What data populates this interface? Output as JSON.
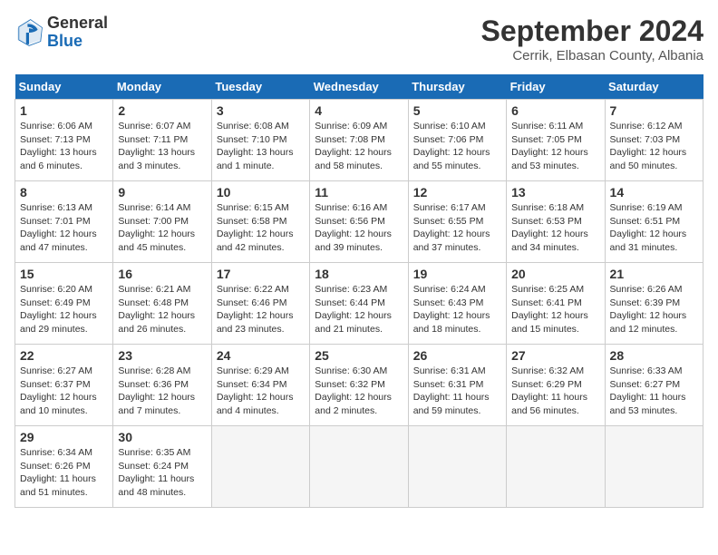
{
  "header": {
    "logo_general": "General",
    "logo_blue": "Blue",
    "month_title": "September 2024",
    "location": "Cerrik, Elbasan County, Albania"
  },
  "columns": [
    "Sunday",
    "Monday",
    "Tuesday",
    "Wednesday",
    "Thursday",
    "Friday",
    "Saturday"
  ],
  "weeks": [
    [
      {
        "day": "1",
        "info": "Sunrise: 6:06 AM\nSunset: 7:13 PM\nDaylight: 13 hours\nand 6 minutes."
      },
      {
        "day": "2",
        "info": "Sunrise: 6:07 AM\nSunset: 7:11 PM\nDaylight: 13 hours\nand 3 minutes."
      },
      {
        "day": "3",
        "info": "Sunrise: 6:08 AM\nSunset: 7:10 PM\nDaylight: 13 hours\nand 1 minute."
      },
      {
        "day": "4",
        "info": "Sunrise: 6:09 AM\nSunset: 7:08 PM\nDaylight: 12 hours\nand 58 minutes."
      },
      {
        "day": "5",
        "info": "Sunrise: 6:10 AM\nSunset: 7:06 PM\nDaylight: 12 hours\nand 55 minutes."
      },
      {
        "day": "6",
        "info": "Sunrise: 6:11 AM\nSunset: 7:05 PM\nDaylight: 12 hours\nand 53 minutes."
      },
      {
        "day": "7",
        "info": "Sunrise: 6:12 AM\nSunset: 7:03 PM\nDaylight: 12 hours\nand 50 minutes."
      }
    ],
    [
      {
        "day": "8",
        "info": "Sunrise: 6:13 AM\nSunset: 7:01 PM\nDaylight: 12 hours\nand 47 minutes."
      },
      {
        "day": "9",
        "info": "Sunrise: 6:14 AM\nSunset: 7:00 PM\nDaylight: 12 hours\nand 45 minutes."
      },
      {
        "day": "10",
        "info": "Sunrise: 6:15 AM\nSunset: 6:58 PM\nDaylight: 12 hours\nand 42 minutes."
      },
      {
        "day": "11",
        "info": "Sunrise: 6:16 AM\nSunset: 6:56 PM\nDaylight: 12 hours\nand 39 minutes."
      },
      {
        "day": "12",
        "info": "Sunrise: 6:17 AM\nSunset: 6:55 PM\nDaylight: 12 hours\nand 37 minutes."
      },
      {
        "day": "13",
        "info": "Sunrise: 6:18 AM\nSunset: 6:53 PM\nDaylight: 12 hours\nand 34 minutes."
      },
      {
        "day": "14",
        "info": "Sunrise: 6:19 AM\nSunset: 6:51 PM\nDaylight: 12 hours\nand 31 minutes."
      }
    ],
    [
      {
        "day": "15",
        "info": "Sunrise: 6:20 AM\nSunset: 6:49 PM\nDaylight: 12 hours\nand 29 minutes."
      },
      {
        "day": "16",
        "info": "Sunrise: 6:21 AM\nSunset: 6:48 PM\nDaylight: 12 hours\nand 26 minutes."
      },
      {
        "day": "17",
        "info": "Sunrise: 6:22 AM\nSunset: 6:46 PM\nDaylight: 12 hours\nand 23 minutes."
      },
      {
        "day": "18",
        "info": "Sunrise: 6:23 AM\nSunset: 6:44 PM\nDaylight: 12 hours\nand 21 minutes."
      },
      {
        "day": "19",
        "info": "Sunrise: 6:24 AM\nSunset: 6:43 PM\nDaylight: 12 hours\nand 18 minutes."
      },
      {
        "day": "20",
        "info": "Sunrise: 6:25 AM\nSunset: 6:41 PM\nDaylight: 12 hours\nand 15 minutes."
      },
      {
        "day": "21",
        "info": "Sunrise: 6:26 AM\nSunset: 6:39 PM\nDaylight: 12 hours\nand 12 minutes."
      }
    ],
    [
      {
        "day": "22",
        "info": "Sunrise: 6:27 AM\nSunset: 6:37 PM\nDaylight: 12 hours\nand 10 minutes."
      },
      {
        "day": "23",
        "info": "Sunrise: 6:28 AM\nSunset: 6:36 PM\nDaylight: 12 hours\nand 7 minutes."
      },
      {
        "day": "24",
        "info": "Sunrise: 6:29 AM\nSunset: 6:34 PM\nDaylight: 12 hours\nand 4 minutes."
      },
      {
        "day": "25",
        "info": "Sunrise: 6:30 AM\nSunset: 6:32 PM\nDaylight: 12 hours\nand 2 minutes."
      },
      {
        "day": "26",
        "info": "Sunrise: 6:31 AM\nSunset: 6:31 PM\nDaylight: 11 hours\nand 59 minutes."
      },
      {
        "day": "27",
        "info": "Sunrise: 6:32 AM\nSunset: 6:29 PM\nDaylight: 11 hours\nand 56 minutes."
      },
      {
        "day": "28",
        "info": "Sunrise: 6:33 AM\nSunset: 6:27 PM\nDaylight: 11 hours\nand 53 minutes."
      }
    ],
    [
      {
        "day": "29",
        "info": "Sunrise: 6:34 AM\nSunset: 6:26 PM\nDaylight: 11 hours\nand 51 minutes."
      },
      {
        "day": "30",
        "info": "Sunrise: 6:35 AM\nSunset: 6:24 PM\nDaylight: 11 hours\nand 48 minutes."
      },
      {
        "day": "",
        "info": ""
      },
      {
        "day": "",
        "info": ""
      },
      {
        "day": "",
        "info": ""
      },
      {
        "day": "",
        "info": ""
      },
      {
        "day": "",
        "info": ""
      }
    ]
  ]
}
